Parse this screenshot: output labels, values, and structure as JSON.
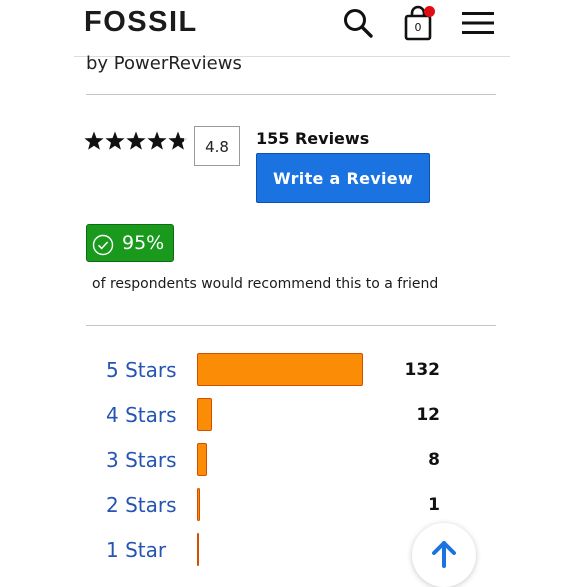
{
  "header": {
    "brand": "FOSSIL",
    "search_icon": "search-icon",
    "cart_icon": "shopping-bag-icon",
    "cart_count": "0",
    "menu_icon": "hamburger-menu-icon"
  },
  "reviews": {
    "byline": "by PowerReviews",
    "rating": "4.8",
    "rating_value": 4.8,
    "review_count": "155 Reviews",
    "write_review_label": "Write a Review",
    "recommend_percent": "95%",
    "recommend_text": "of respondents would recommend this to a friend",
    "histogram": [
      {
        "label": "5 Stars",
        "count": "132",
        "value": 132
      },
      {
        "label": "4 Stars",
        "count": "12",
        "value": 12
      },
      {
        "label": "3 Stars",
        "count": "8",
        "value": 8
      },
      {
        "label": "2 Stars",
        "count": "1",
        "value": 1
      },
      {
        "label": "1 Star",
        "count": "",
        "value": 0
      }
    ]
  },
  "back_to_top_icon": "arrow-up-icon",
  "colors": {
    "brand_text": "#1b1b1b",
    "button_blue": "#1a73e0",
    "recommend_green": "#199a1c",
    "bar_orange": "#fb8c06",
    "star_link_blue": "#2554b3",
    "cart_dot_red": "#e10d14"
  }
}
